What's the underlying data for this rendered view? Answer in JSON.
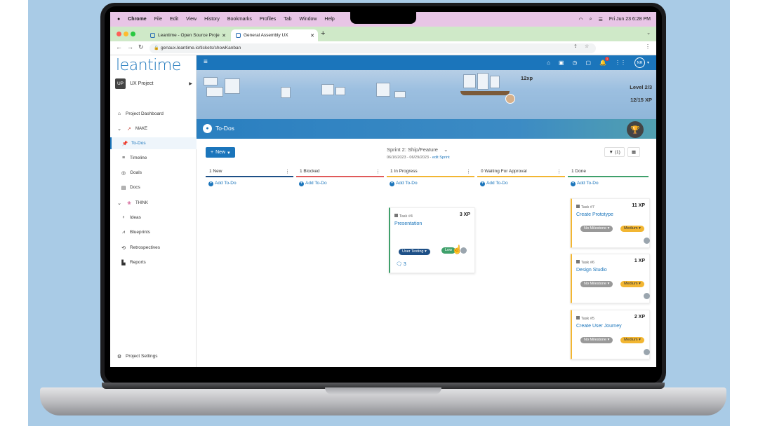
{
  "menubar": {
    "apple": "",
    "items": [
      "Chrome",
      "File",
      "Edit",
      "View",
      "History",
      "Bookmarks",
      "Profiles",
      "Tab",
      "Window",
      "Help"
    ],
    "datetime": "Fri Jun 23  6:28 PM"
  },
  "browser": {
    "tabs": [
      {
        "title": "Leantime - Open Source Proje"
      },
      {
        "title": "General Assembly UX"
      }
    ],
    "new_tab": "+",
    "url": "genaux.leantime.io/tickets/showKanban"
  },
  "sidebar": {
    "logo": "leantime",
    "project_badge": "UP",
    "project_name": "UX Project",
    "dashboard": "Project Dashboard",
    "make_label": "MAKE",
    "make_items": [
      "To-Dos",
      "Timeline",
      "Goals",
      "Docs"
    ],
    "think_label": "THINK",
    "think_items": [
      "Ideas",
      "Blueprints",
      "Retrospectives",
      "Reports"
    ],
    "settings": "Project Settings"
  },
  "topnav": {
    "avatar": "NR",
    "notification_count": "1"
  },
  "banner": {
    "xp": "12xp",
    "level": "Level 2/3",
    "progress": "12/15 XP"
  },
  "page": {
    "title": "To-Dos"
  },
  "board": {
    "new_button": "New",
    "sprint_name": "Sprint 2: Ship/Feature",
    "sprint_dates": "06/16/2023 - 06/29/2023 - ",
    "sprint_edit": "edit Sprint",
    "filter_label": "(1)",
    "add_todo": "Add To-Do",
    "columns": [
      {
        "label": "1 New",
        "color": "#1d4f86"
      },
      {
        "label": "1 Blocked",
        "color": "#e05a5a"
      },
      {
        "label": "1 In Progress",
        "color": "#f2b632"
      },
      {
        "label": "0 Waiting For Approval",
        "color": "#f2b632"
      },
      {
        "label": "1 Done",
        "color": "#3fa06b"
      }
    ],
    "inprogress_card": {
      "task": "Task #4",
      "xp": "3 XP",
      "title": "Presentation",
      "status": "User Testing",
      "tag": "Low",
      "comments": "3"
    },
    "done_cards": [
      {
        "task": "Task #7",
        "xp": "11 XP",
        "title": "Create Prototype",
        "milestone": "No Milestone",
        "priority": "Medium"
      },
      {
        "task": "Task #6",
        "xp": "1 XP",
        "title": "Design Studio",
        "milestone": "No Milestone",
        "priority": "Medium"
      },
      {
        "task": "Task #5",
        "xp": "2 XP",
        "title": "Create User Journey",
        "milestone": "No Milestone",
        "priority": "Medium"
      }
    ]
  }
}
